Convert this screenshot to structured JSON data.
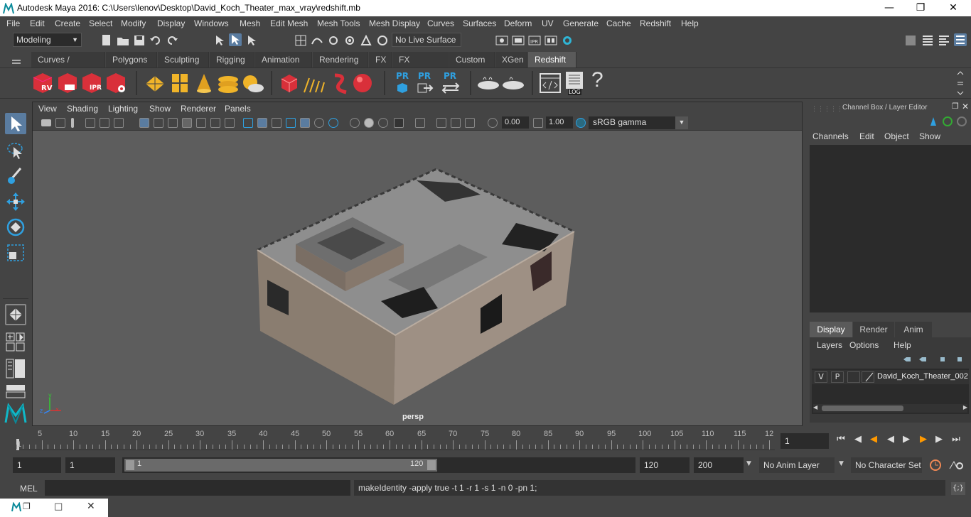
{
  "window": {
    "title": "Autodesk Maya 2016: C:\\Users\\lenov\\Desktop\\David_Koch_Theater_max_vray\\redshift.mb"
  },
  "menubar": {
    "items": [
      "File",
      "Edit",
      "Create",
      "Select",
      "Modify",
      "Display",
      "Windows",
      "Mesh",
      "Edit Mesh",
      "Mesh Tools",
      "Mesh Display",
      "Curves",
      "Surfaces",
      "Deform",
      "UV",
      "Generate",
      "Cache",
      "Redshift",
      "Help"
    ]
  },
  "statusline": {
    "mode": "Modeling",
    "live_surface": "No Live Surface"
  },
  "shelf": {
    "tabs": [
      "Curves / Surfaces",
      "Polygons",
      "Sculpting",
      "Rigging",
      "Animation",
      "Rendering",
      "FX",
      "FX Caching",
      "Custom",
      "XGen",
      "Redshift"
    ],
    "active_tab": "Redshift",
    "rv_label": "RV",
    "ipr_label": "IPR",
    "pr_labels": [
      "PR",
      "PR",
      "PR"
    ],
    "log_label": "LOG",
    "help_label": "?"
  },
  "viewport": {
    "menu": [
      "View",
      "Shading",
      "Lighting",
      "Show",
      "Renderer",
      "Panels"
    ],
    "exposure": "0.00",
    "gamma": "1.00",
    "colorspace": "sRGB gamma",
    "camera_label": "persp",
    "axis_x": "x",
    "axis_y": "y",
    "axis_z": "z"
  },
  "channel_box": {
    "title": "Channel Box / Layer Editor",
    "menu": [
      "Channels",
      "Edit",
      "Object",
      "Show"
    ],
    "layer_tabs": [
      "Display",
      "Render",
      "Anim"
    ],
    "active_layer_tab": "Display",
    "layer_menu": [
      "Layers",
      "Options",
      "Help"
    ],
    "layer": {
      "v": "V",
      "p": "P",
      "name": "David_Koch_Theater_002"
    }
  },
  "timeline": {
    "ticks": [
      "5",
      "10",
      "15",
      "20",
      "25",
      "30",
      "35",
      "40",
      "45",
      "50",
      "55",
      "60",
      "65",
      "70",
      "75",
      "80",
      "85",
      "90",
      "95",
      "100",
      "105",
      "110",
      "115",
      "12"
    ],
    "start_marker": "1",
    "current_frame": "1"
  },
  "range": {
    "start": "1",
    "playback_start": "1",
    "slider_start": "1",
    "slider_end": "120",
    "playback_end": "120",
    "end": "200",
    "anim_layer": "No Anim Layer",
    "char_set": "No Character Set"
  },
  "command": {
    "label": "MEL",
    "output": "makeIdentity -apply true -t 1 -r 1 -s 1 -n 0 -pn 1;"
  }
}
